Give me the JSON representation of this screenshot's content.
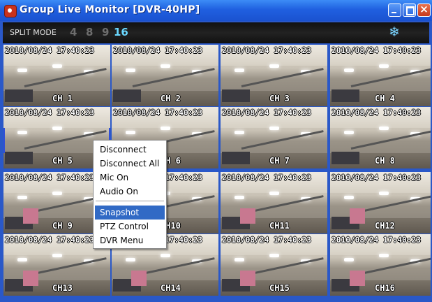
{
  "window": {
    "title": "Group Live Monitor [DVR-40HP]"
  },
  "toolbar": {
    "split_label": "SPLIT MODE",
    "split_options": [
      "4",
      "8",
      "9",
      "16"
    ],
    "active_split": "16",
    "settings_icon": "snowflake-icon"
  },
  "cells": [
    {
      "timestamp": "2010/08/24 17:40:23",
      "channel": "CH 1"
    },
    {
      "timestamp": "2010/08/24 17:40:23",
      "channel": "CH 2"
    },
    {
      "timestamp": "2010/08/24 17:40:23",
      "channel": "CH 3"
    },
    {
      "timestamp": "2010/08/24 17:40:23",
      "channel": "CH 4"
    },
    {
      "timestamp": "2010/08/24 17:40:23",
      "channel": "CH 5"
    },
    {
      "timestamp": "2010/08/24 17:40:23",
      "channel": "CH 6"
    },
    {
      "timestamp": "2010/08/24 17:40:23",
      "channel": "CH 7"
    },
    {
      "timestamp": "2010/08/24 17:40:23",
      "channel": "CH 8"
    },
    {
      "timestamp": "2010/08/24 17:40:23",
      "channel": "CH 9"
    },
    {
      "timestamp": "2010/08/24 17:40:23",
      "channel": "CH10"
    },
    {
      "timestamp": "2010/08/24 17:40:23",
      "channel": "CH11"
    },
    {
      "timestamp": "2010/08/24 17:40:23",
      "channel": "CH12"
    },
    {
      "timestamp": "2010/08/24 17:40:23",
      "channel": "CH13"
    },
    {
      "timestamp": "2010/08/24 17:40:23",
      "channel": "CH14"
    },
    {
      "timestamp": "2010/08/24 17:40:23",
      "channel": "CH15"
    },
    {
      "timestamp": "2010/08/24 17:40:23",
      "channel": "CH16"
    }
  ],
  "context_menu": {
    "items": [
      "Disconnect",
      "Disconnect All",
      "Mic On",
      "Audio On",
      "Snapshot",
      "PTZ Control",
      "DVR Menu"
    ],
    "highlighted": "Snapshot"
  },
  "colors": {
    "title_bar": "#2060e0",
    "active_split": "#6ad8ff",
    "menu_highlight": "#316ac5",
    "selected_cell_border": "#3050d8"
  }
}
